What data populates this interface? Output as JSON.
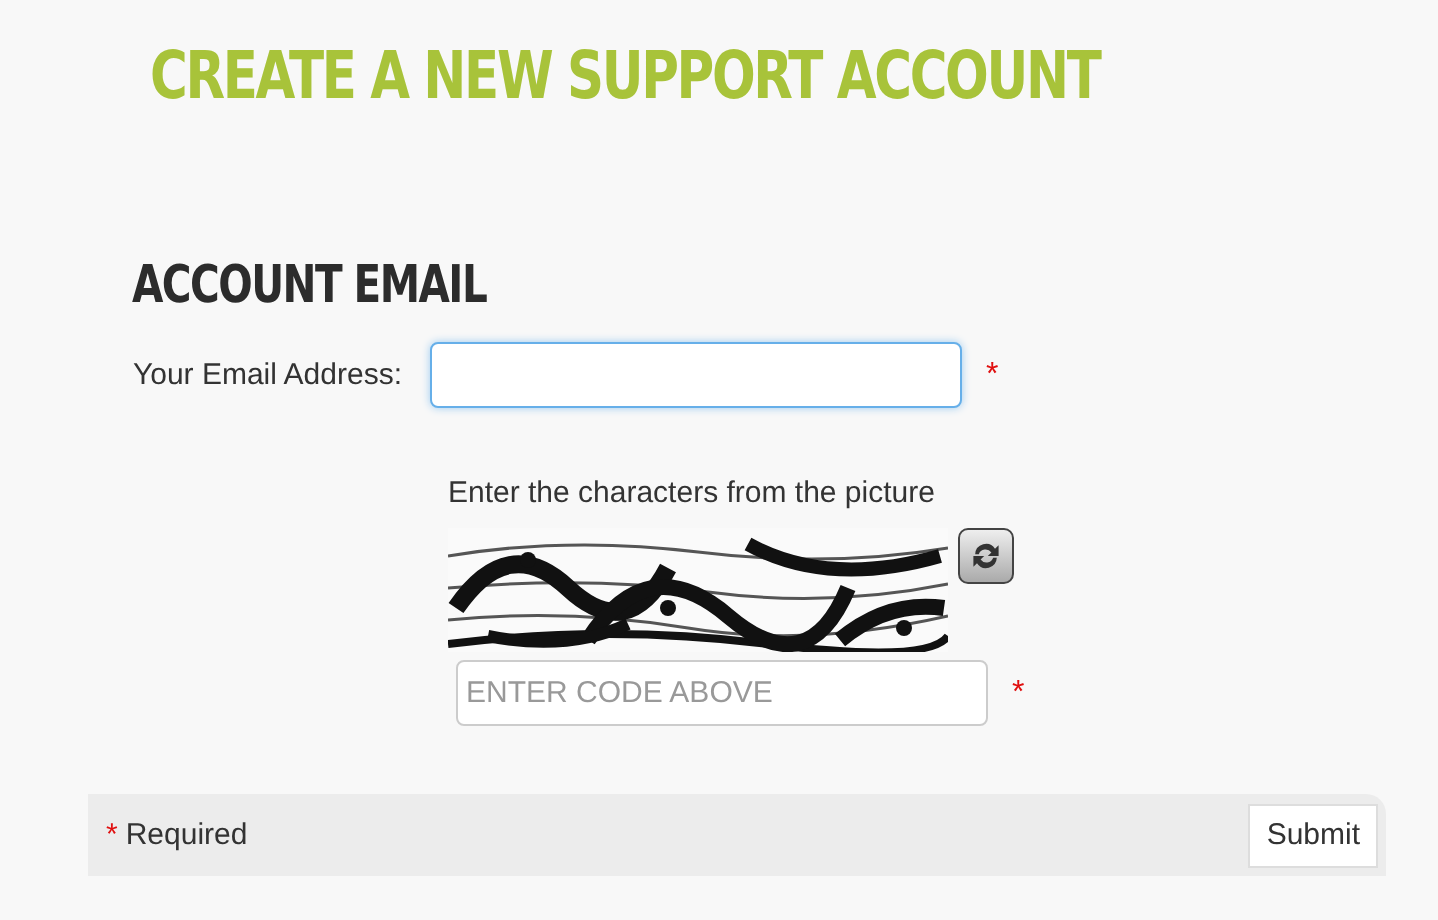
{
  "page_title": "CREATE A NEW SUPPORT ACCOUNT",
  "section_title": "ACCOUNT EMAIL",
  "email_field": {
    "label": "Your Email Address:",
    "focused": true,
    "required_mark": "*"
  },
  "captcha": {
    "instruction": "Enter the characters from the picture",
    "code_field": {
      "placeholder": "ENTER CODE ABOVE",
      "focused": false,
      "required_mark": "*"
    }
  },
  "footer": {
    "required_mark": "*",
    "required_note": "Required",
    "buttons": [
      "Submit"
    ]
  }
}
